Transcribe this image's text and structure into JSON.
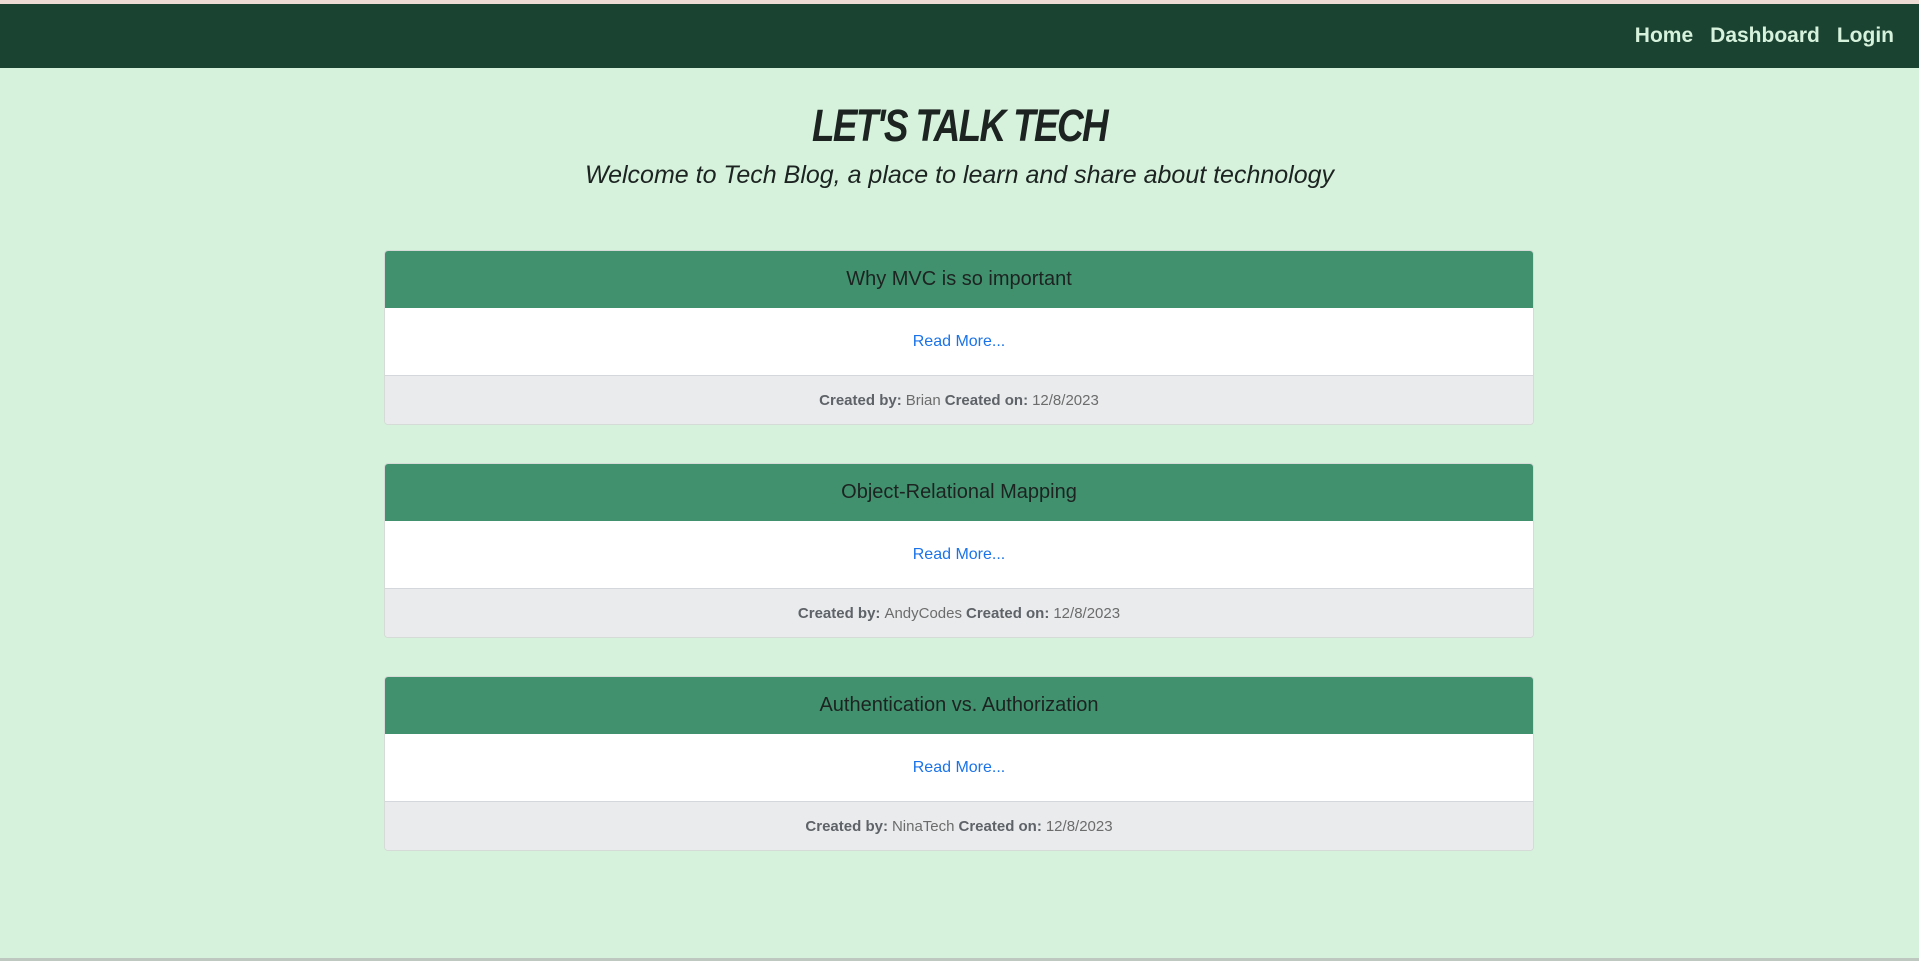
{
  "nav": {
    "links": [
      "Home",
      "Dashboard",
      "Login"
    ]
  },
  "hero": {
    "title": "LET'S TALK TECH",
    "subtitle": "Welcome to Tech Blog, a place to learn and share about technology"
  },
  "posts": [
    {
      "title": "Why MVC is so important",
      "read_more": "Read More...",
      "created_by_label": "Created by:",
      "author": "Brian",
      "created_on_label": "Created on:",
      "date": "12/8/2023"
    },
    {
      "title": "Object-Relational Mapping",
      "read_more": "Read More...",
      "created_by_label": "Created by:",
      "author": "AndyCodes",
      "created_on_label": "Created on:",
      "date": "12/8/2023"
    },
    {
      "title": "Authentication vs. Authorization",
      "read_more": "Read More...",
      "created_by_label": "Created by:",
      "author": "NinaTech",
      "created_on_label": "Created on:",
      "date": "12/8/2023"
    }
  ],
  "colors": {
    "page_background": "#d6f2dc",
    "navbar_background": "#1b4332",
    "card_header": "#41916e",
    "link": "#1a73e8"
  }
}
